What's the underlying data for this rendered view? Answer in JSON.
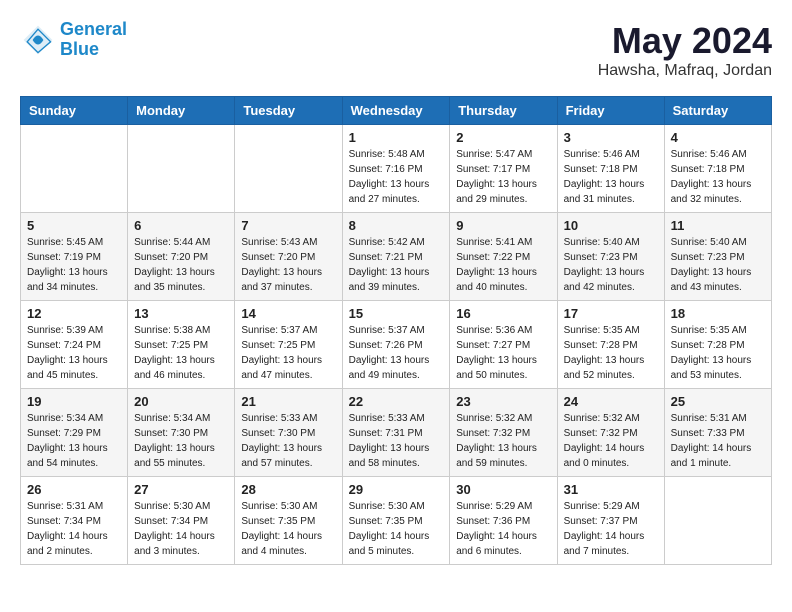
{
  "logo": {
    "line1": "General",
    "line2": "Blue"
  },
  "title": "May 2024",
  "location": "Hawsha, Mafraq, Jordan",
  "weekdays": [
    "Sunday",
    "Monday",
    "Tuesday",
    "Wednesday",
    "Thursday",
    "Friday",
    "Saturday"
  ],
  "weeks": [
    [
      {
        "day": "",
        "info": ""
      },
      {
        "day": "",
        "info": ""
      },
      {
        "day": "",
        "info": ""
      },
      {
        "day": "1",
        "info": "Sunrise: 5:48 AM\nSunset: 7:16 PM\nDaylight: 13 hours\nand 27 minutes."
      },
      {
        "day": "2",
        "info": "Sunrise: 5:47 AM\nSunset: 7:17 PM\nDaylight: 13 hours\nand 29 minutes."
      },
      {
        "day": "3",
        "info": "Sunrise: 5:46 AM\nSunset: 7:18 PM\nDaylight: 13 hours\nand 31 minutes."
      },
      {
        "day": "4",
        "info": "Sunrise: 5:46 AM\nSunset: 7:18 PM\nDaylight: 13 hours\nand 32 minutes."
      }
    ],
    [
      {
        "day": "5",
        "info": "Sunrise: 5:45 AM\nSunset: 7:19 PM\nDaylight: 13 hours\nand 34 minutes."
      },
      {
        "day": "6",
        "info": "Sunrise: 5:44 AM\nSunset: 7:20 PM\nDaylight: 13 hours\nand 35 minutes."
      },
      {
        "day": "7",
        "info": "Sunrise: 5:43 AM\nSunset: 7:20 PM\nDaylight: 13 hours\nand 37 minutes."
      },
      {
        "day": "8",
        "info": "Sunrise: 5:42 AM\nSunset: 7:21 PM\nDaylight: 13 hours\nand 39 minutes."
      },
      {
        "day": "9",
        "info": "Sunrise: 5:41 AM\nSunset: 7:22 PM\nDaylight: 13 hours\nand 40 minutes."
      },
      {
        "day": "10",
        "info": "Sunrise: 5:40 AM\nSunset: 7:23 PM\nDaylight: 13 hours\nand 42 minutes."
      },
      {
        "day": "11",
        "info": "Sunrise: 5:40 AM\nSunset: 7:23 PM\nDaylight: 13 hours\nand 43 minutes."
      }
    ],
    [
      {
        "day": "12",
        "info": "Sunrise: 5:39 AM\nSunset: 7:24 PM\nDaylight: 13 hours\nand 45 minutes."
      },
      {
        "day": "13",
        "info": "Sunrise: 5:38 AM\nSunset: 7:25 PM\nDaylight: 13 hours\nand 46 minutes."
      },
      {
        "day": "14",
        "info": "Sunrise: 5:37 AM\nSunset: 7:25 PM\nDaylight: 13 hours\nand 47 minutes."
      },
      {
        "day": "15",
        "info": "Sunrise: 5:37 AM\nSunset: 7:26 PM\nDaylight: 13 hours\nand 49 minutes."
      },
      {
        "day": "16",
        "info": "Sunrise: 5:36 AM\nSunset: 7:27 PM\nDaylight: 13 hours\nand 50 minutes."
      },
      {
        "day": "17",
        "info": "Sunrise: 5:35 AM\nSunset: 7:28 PM\nDaylight: 13 hours\nand 52 minutes."
      },
      {
        "day": "18",
        "info": "Sunrise: 5:35 AM\nSunset: 7:28 PM\nDaylight: 13 hours\nand 53 minutes."
      }
    ],
    [
      {
        "day": "19",
        "info": "Sunrise: 5:34 AM\nSunset: 7:29 PM\nDaylight: 13 hours\nand 54 minutes."
      },
      {
        "day": "20",
        "info": "Sunrise: 5:34 AM\nSunset: 7:30 PM\nDaylight: 13 hours\nand 55 minutes."
      },
      {
        "day": "21",
        "info": "Sunrise: 5:33 AM\nSunset: 7:30 PM\nDaylight: 13 hours\nand 57 minutes."
      },
      {
        "day": "22",
        "info": "Sunrise: 5:33 AM\nSunset: 7:31 PM\nDaylight: 13 hours\nand 58 minutes."
      },
      {
        "day": "23",
        "info": "Sunrise: 5:32 AM\nSunset: 7:32 PM\nDaylight: 13 hours\nand 59 minutes."
      },
      {
        "day": "24",
        "info": "Sunrise: 5:32 AM\nSunset: 7:32 PM\nDaylight: 14 hours\nand 0 minutes."
      },
      {
        "day": "25",
        "info": "Sunrise: 5:31 AM\nSunset: 7:33 PM\nDaylight: 14 hours\nand 1 minute."
      }
    ],
    [
      {
        "day": "26",
        "info": "Sunrise: 5:31 AM\nSunset: 7:34 PM\nDaylight: 14 hours\nand 2 minutes."
      },
      {
        "day": "27",
        "info": "Sunrise: 5:30 AM\nSunset: 7:34 PM\nDaylight: 14 hours\nand 3 minutes."
      },
      {
        "day": "28",
        "info": "Sunrise: 5:30 AM\nSunset: 7:35 PM\nDaylight: 14 hours\nand 4 minutes."
      },
      {
        "day": "29",
        "info": "Sunrise: 5:30 AM\nSunset: 7:35 PM\nDaylight: 14 hours\nand 5 minutes."
      },
      {
        "day": "30",
        "info": "Sunrise: 5:29 AM\nSunset: 7:36 PM\nDaylight: 14 hours\nand 6 minutes."
      },
      {
        "day": "31",
        "info": "Sunrise: 5:29 AM\nSunset: 7:37 PM\nDaylight: 14 hours\nand 7 minutes."
      },
      {
        "day": "",
        "info": ""
      }
    ]
  ]
}
